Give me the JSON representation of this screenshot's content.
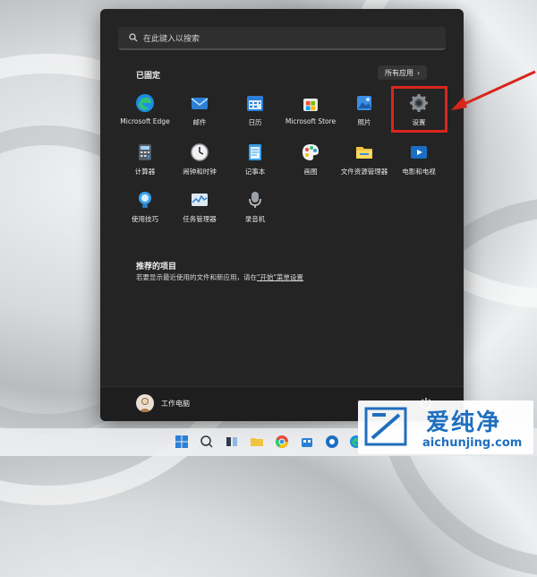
{
  "search": {
    "placeholder": "在此键入以搜索"
  },
  "pinned": {
    "title": "已固定",
    "all_apps_label": "所有应用",
    "apps": [
      {
        "label": "Microsoft Edge",
        "icon": "edge-icon"
      },
      {
        "label": "邮件",
        "icon": "mail-icon"
      },
      {
        "label": "日历",
        "icon": "calendar-icon"
      },
      {
        "label": "Microsoft Store",
        "icon": "store-icon"
      },
      {
        "label": "照片",
        "icon": "photos-icon"
      },
      {
        "label": "设置",
        "icon": "settings-gear-icon"
      },
      {
        "label": "计算器",
        "icon": "calculator-icon"
      },
      {
        "label": "闹钟和时钟",
        "icon": "clock-icon"
      },
      {
        "label": "记事本",
        "icon": "notepad-icon"
      },
      {
        "label": "画图",
        "icon": "paint-icon"
      },
      {
        "label": "文件资源管理器",
        "icon": "folder-icon"
      },
      {
        "label": "电影和电视",
        "icon": "movies-icon"
      },
      {
        "label": "使用技巧",
        "icon": "tips-icon"
      },
      {
        "label": "任务管理器",
        "icon": "task-manager-icon"
      },
      {
        "label": "录音机",
        "icon": "voice-recorder-icon"
      }
    ]
  },
  "recommended": {
    "title": "推荐的项目",
    "text_before": "若要显示最近使用的文件和新应用，请在",
    "link": "\"开始\"菜单设置",
    "text_after": ""
  },
  "footer": {
    "user_name": "工作电脑"
  },
  "watermark": {
    "brand": "爱纯净",
    "url": "aichunjing.com"
  },
  "colors": {
    "menu_bg": "#242424",
    "highlight": "#d9261c",
    "accent": "#1f6fbf"
  }
}
